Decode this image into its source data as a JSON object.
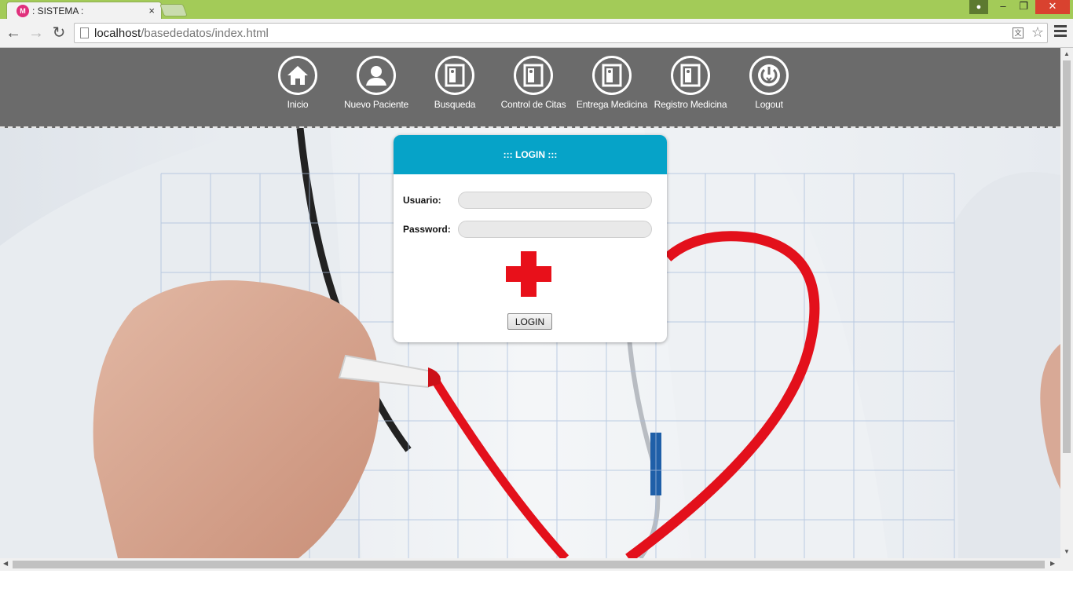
{
  "browser": {
    "tab_title": ": SISTEMA :",
    "tab_favicon": "M",
    "tab_close": "×",
    "url_host": "localhost",
    "url_path": "/basededatos/index.html"
  },
  "nav": {
    "items": [
      {
        "label": "Inicio",
        "icon": "home-icon"
      },
      {
        "label": "Nuevo Paciente",
        "icon": "user-icon"
      },
      {
        "label": "Busqueda",
        "icon": "door-icon"
      },
      {
        "label": "Control de Citas",
        "icon": "door-icon"
      },
      {
        "label": "Entrega Medicina",
        "icon": "door-icon"
      },
      {
        "label": "Registro Medicina",
        "icon": "door-icon"
      },
      {
        "label": "Logout",
        "icon": "power-icon"
      }
    ]
  },
  "login": {
    "title": "::: LOGIN :::",
    "user_label": "Usuario:",
    "user_value": "",
    "password_label": "Password:",
    "password_value": "",
    "button": "LOGIN"
  },
  "colors": {
    "chrome_green": "#a3cb58",
    "nav_bg": "#6b6b6b",
    "login_header": "#06a3c8",
    "cross_red": "#e8101a",
    "heart_red": "#e3101b"
  }
}
